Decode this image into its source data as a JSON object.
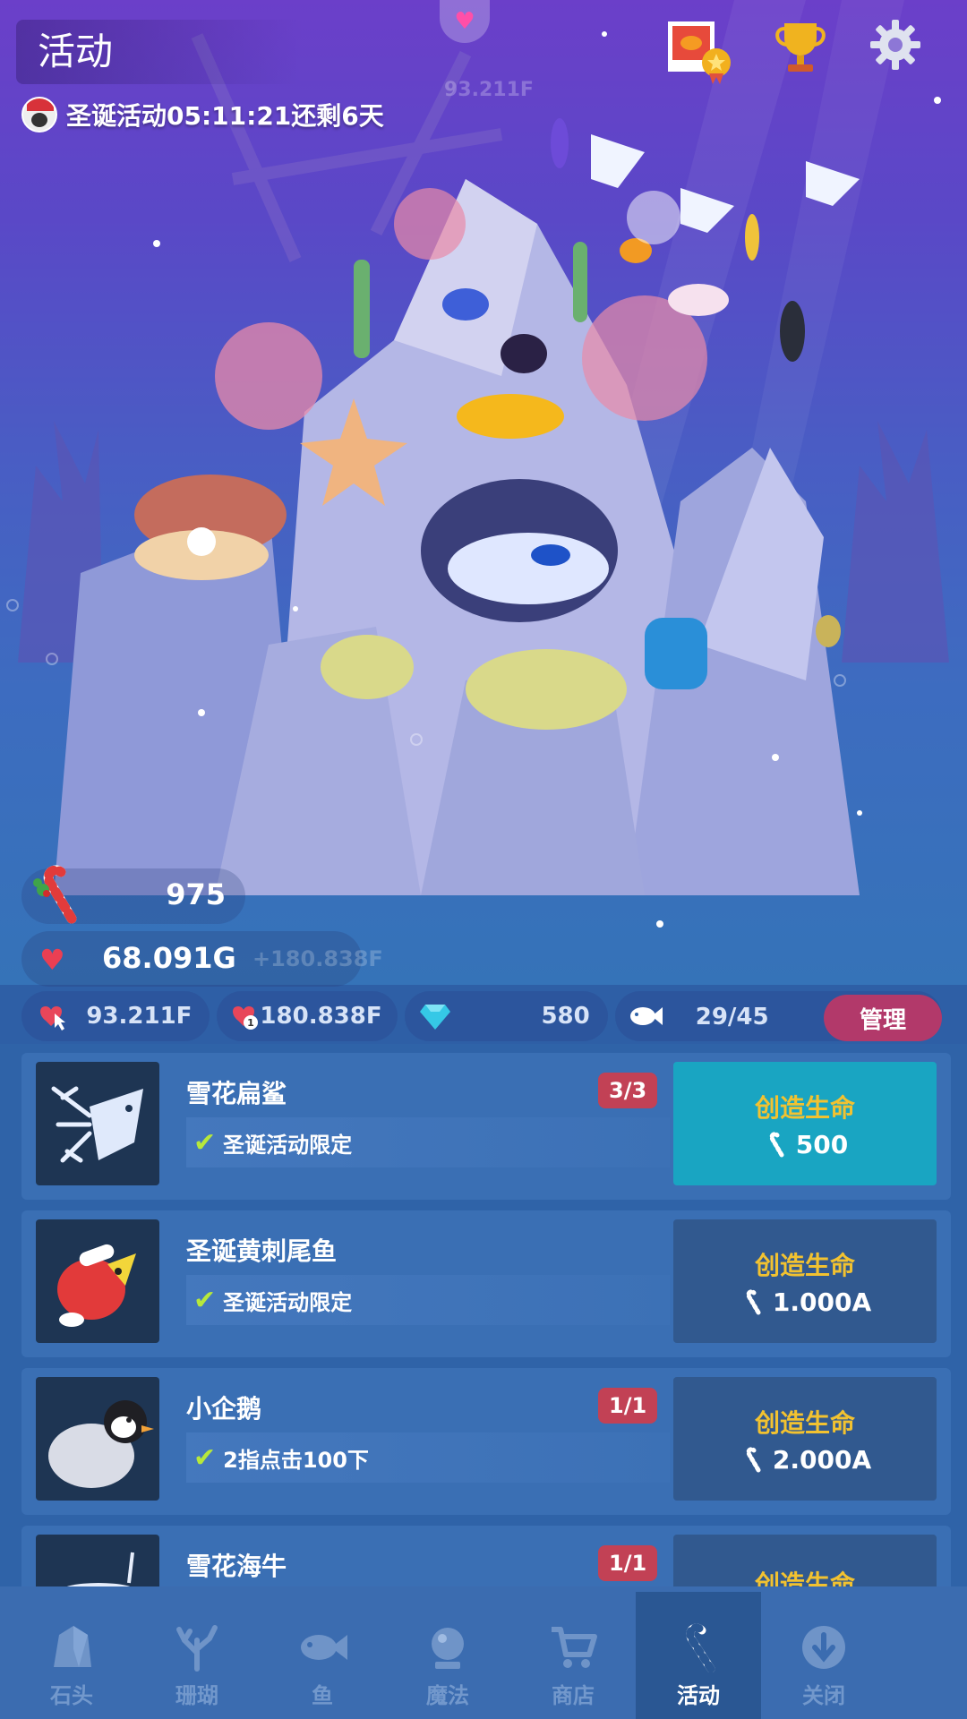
{
  "header": {
    "title": "活动",
    "event_text": "圣诞活动05:11:21还剩6天",
    "faint_rate": "93.211F"
  },
  "resources": {
    "candy": "975",
    "hearts": "68.091G",
    "hearts_rate": "+180.838F",
    "tap_rate": "93.211F",
    "passive_rate": "180.838F",
    "gems": "580",
    "fish_count": "29/45",
    "manage_label": "管理"
  },
  "items": [
    {
      "name": "雪花扁鲨",
      "count": "3/3",
      "requirement": "圣诞活动限定",
      "create_label": "创造生命",
      "cost": "500",
      "active": true
    },
    {
      "name": "圣诞黄刺尾鱼",
      "count": "",
      "requirement": "圣诞活动限定",
      "create_label": "创造生命",
      "cost": "1.000A",
      "active": false
    },
    {
      "name": "小企鹅",
      "count": "1/1",
      "requirement": "2指点击100下",
      "create_label": "创造生命",
      "cost": "2.000A",
      "active": false
    },
    {
      "name": "雪花海牛",
      "count": "1/1",
      "requirement": "",
      "create_label": "创造生命",
      "cost": "",
      "active": false
    }
  ],
  "nav": [
    {
      "label": "石头",
      "icon": "rock-icon"
    },
    {
      "label": "珊瑚",
      "icon": "coral-icon"
    },
    {
      "label": "鱼",
      "icon": "fish-icon"
    },
    {
      "label": "魔法",
      "icon": "magic-orb-icon"
    },
    {
      "label": "商店",
      "icon": "cart-icon"
    },
    {
      "label": "活动",
      "icon": "candy-cane-icon",
      "active": true
    },
    {
      "label": "关闭",
      "icon": "close-arrow-icon"
    }
  ],
  "colors": {
    "accent_active": "#19a5c2",
    "badge": "#c24155",
    "manage": "#b2396a",
    "gold_text": "#f2c230"
  }
}
